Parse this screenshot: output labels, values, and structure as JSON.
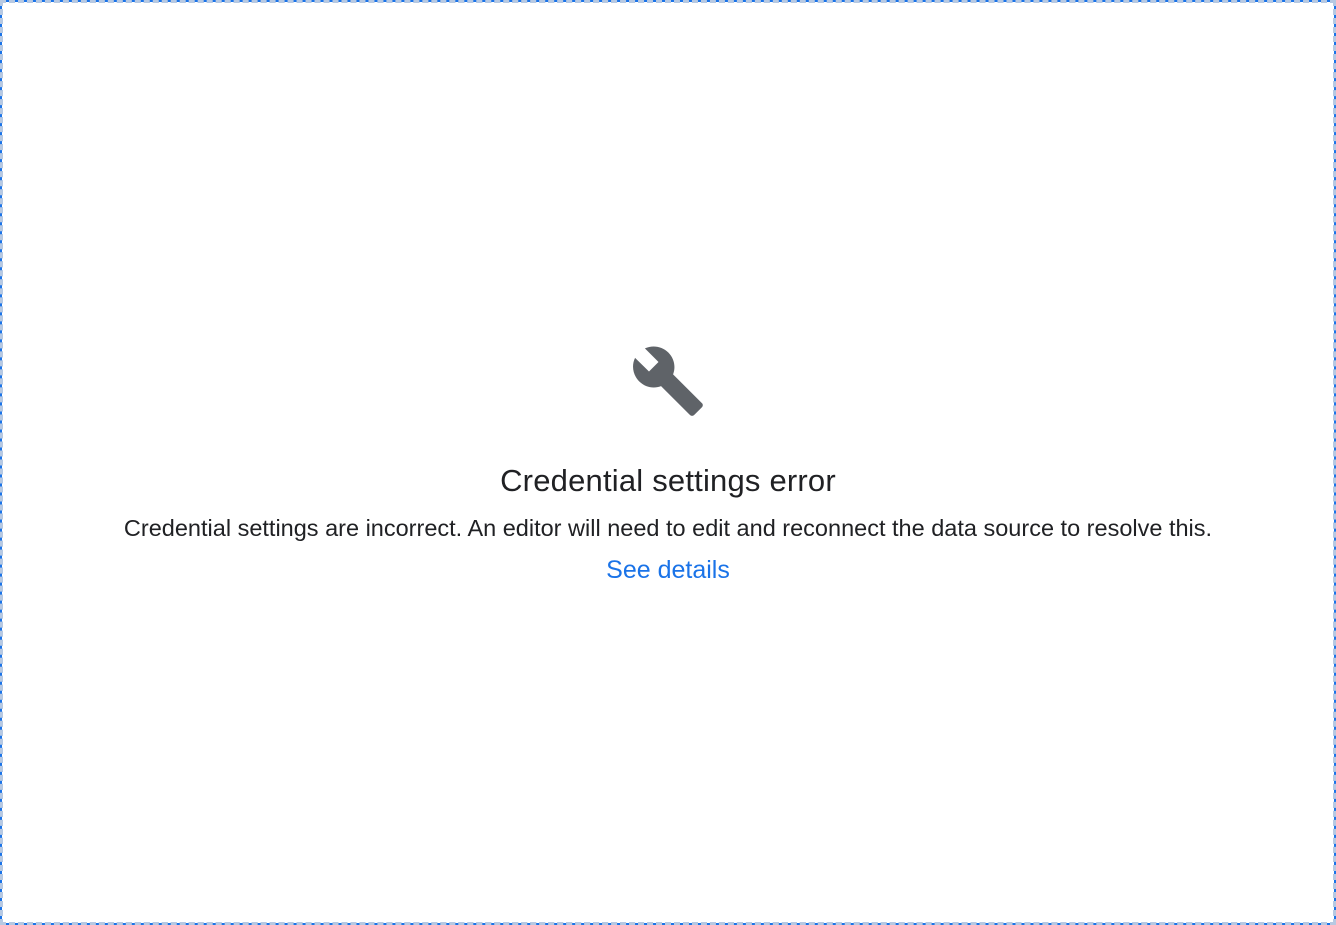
{
  "error": {
    "icon": "wrench-icon",
    "icon_color": "#5f6368",
    "title": "Credential settings error",
    "message": "Credential settings are incorrect. An editor will need to edit and reconnect the data source to resolve this.",
    "link_label": "See details",
    "link_color": "#1a73e8"
  },
  "frame": {
    "border_color": "#1a73e8",
    "dash_color": "#b7c9e2"
  }
}
